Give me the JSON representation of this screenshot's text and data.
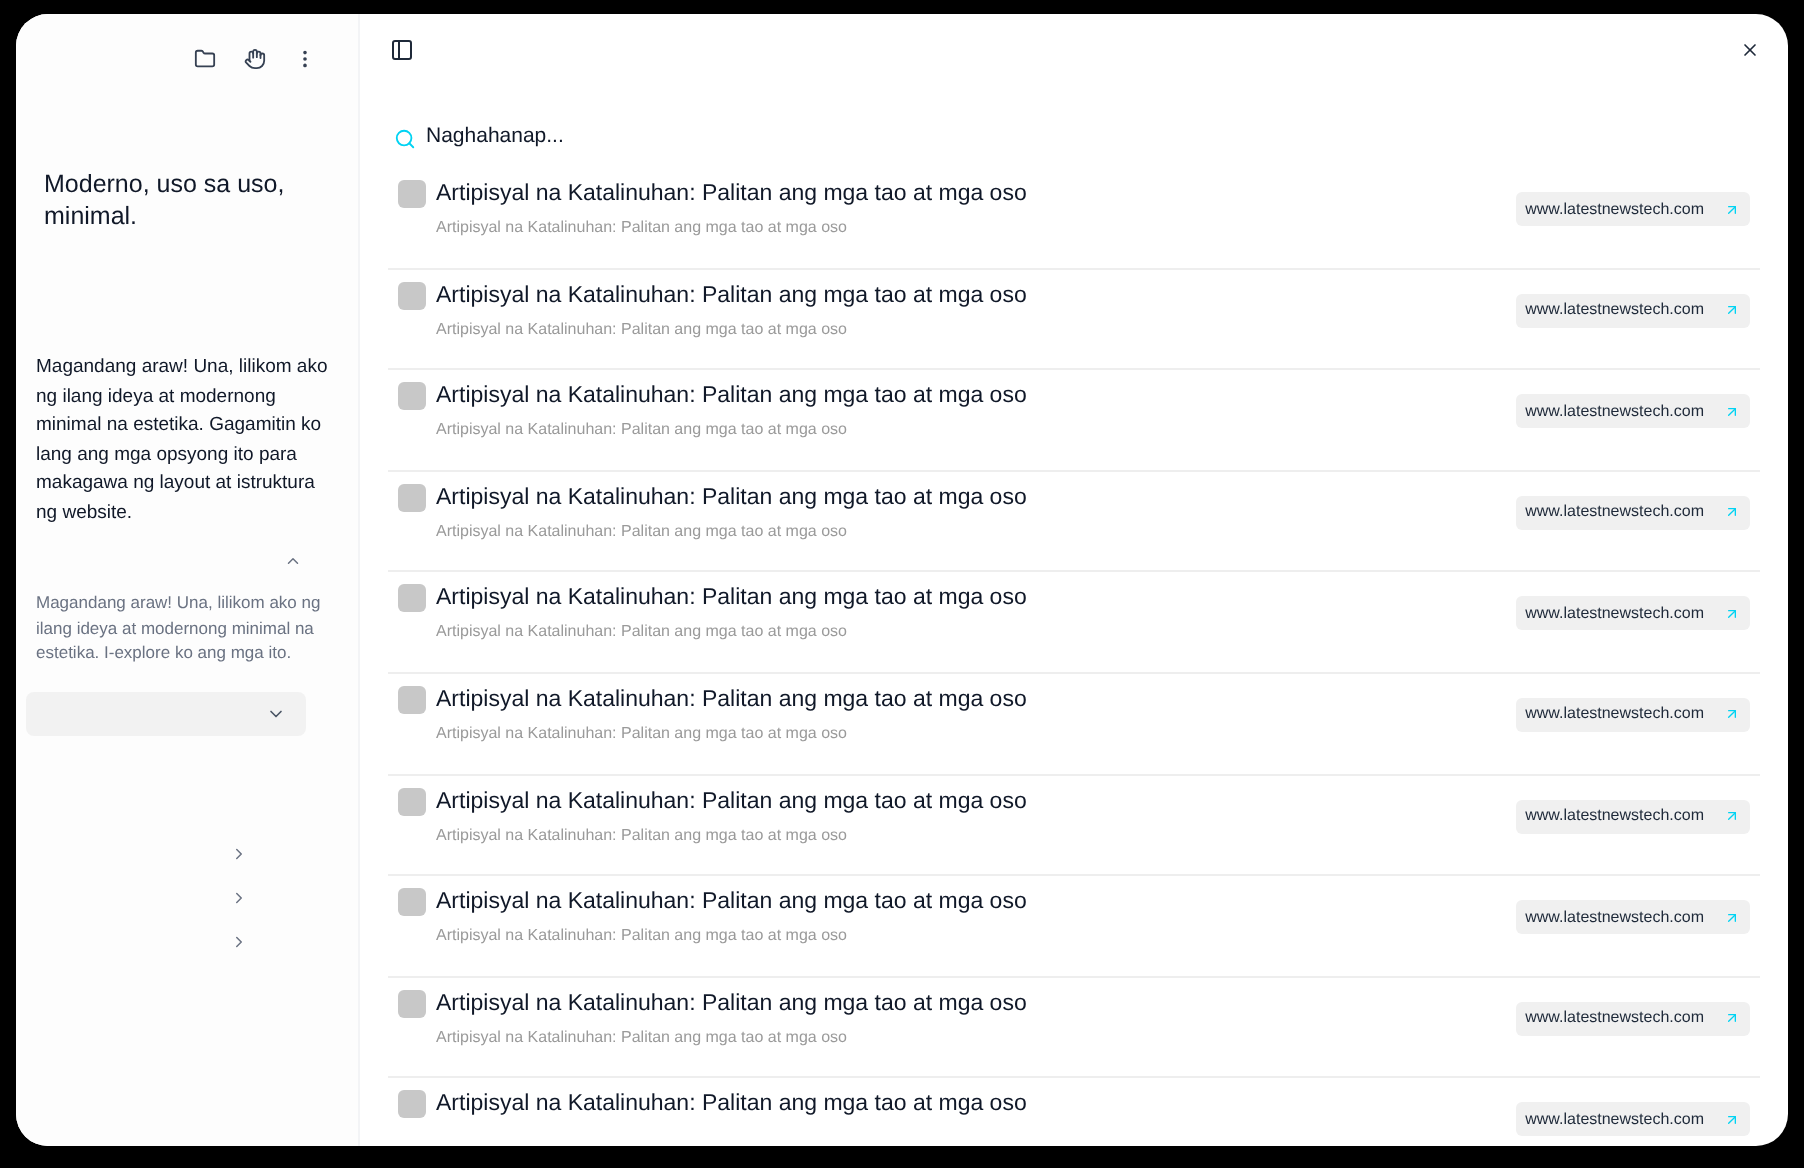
{
  "sidebar": {
    "heading": "Moderno, uso sa uso, minimal.",
    "intro": "Magandang araw! Una, lilikom ako ng ilang ideya at modernong minimal na estetika. Gagamitin ko lang ang mga opsyong ito para makagawa ng layout at istruktura ng website.",
    "section": {
      "expanded": true,
      "text": "Magandang araw! Una, lilikom ako ng ilang ideya at modernong minimal na estetika. I-explore ko ang mga ito."
    },
    "dropdown": {
      "expanded": false
    },
    "nav_items": [
      {
        "expanded": false
      },
      {
        "expanded": false
      },
      {
        "expanded": false
      }
    ]
  },
  "search": {
    "value": "Naghahanap..."
  },
  "results": [
    {
      "title": "Artipisyal na Katalinuhan: Palitan ang mga tao at mga oso",
      "subtitle": "Artipisyal na Katalinuhan: Palitan ang mga tao at mga oso",
      "source": "www.latestnewstech.com",
      "checked": false
    },
    {
      "title": "Artipisyal na Katalinuhan: Palitan ang mga tao at mga oso",
      "subtitle": "Artipisyal na Katalinuhan: Palitan ang mga tao at mga oso",
      "source": "www.latestnewstech.com",
      "checked": false
    },
    {
      "title": "Artipisyal na Katalinuhan: Palitan ang mga tao at mga oso",
      "subtitle": "Artipisyal na Katalinuhan: Palitan ang mga tao at mga oso",
      "source": "www.latestnewstech.com",
      "checked": false
    },
    {
      "title": "Artipisyal na Katalinuhan: Palitan ang mga tao at mga oso",
      "subtitle": "Artipisyal na Katalinuhan: Palitan ang mga tao at mga oso",
      "source": "www.latestnewstech.com",
      "checked": false
    },
    {
      "title": "Artipisyal na Katalinuhan: Palitan ang mga tao at mga oso",
      "subtitle": "Artipisyal na Katalinuhan: Palitan ang mga tao at mga oso",
      "source": "www.latestnewstech.com",
      "checked": false
    },
    {
      "title": "Artipisyal na Katalinuhan: Palitan ang mga tao at mga oso",
      "subtitle": "Artipisyal na Katalinuhan: Palitan ang mga tao at mga oso",
      "source": "www.latestnewstech.com",
      "checked": false
    },
    {
      "title": "Artipisyal na Katalinuhan: Palitan ang mga tao at mga oso",
      "subtitle": "Artipisyal na Katalinuhan: Palitan ang mga tao at mga oso",
      "source": "www.latestnewstech.com",
      "checked": false
    },
    {
      "title": "Artipisyal na Katalinuhan: Palitan ang mga tao at mga oso",
      "subtitle": "Artipisyal na Katalinuhan: Palitan ang mga tao at mga oso",
      "source": "www.latestnewstech.com",
      "checked": false
    },
    {
      "title": "Artipisyal na Katalinuhan: Palitan ang mga tao at mga oso",
      "subtitle": "Artipisyal na Katalinuhan: Palitan ang mga tao at mga oso",
      "source": "www.latestnewstech.com",
      "checked": false
    },
    {
      "title": "Artipisyal na Katalinuhan: Palitan ang mga tao at mga oso",
      "source": "www.latestnewstech.com",
      "checked": false
    }
  ]
}
